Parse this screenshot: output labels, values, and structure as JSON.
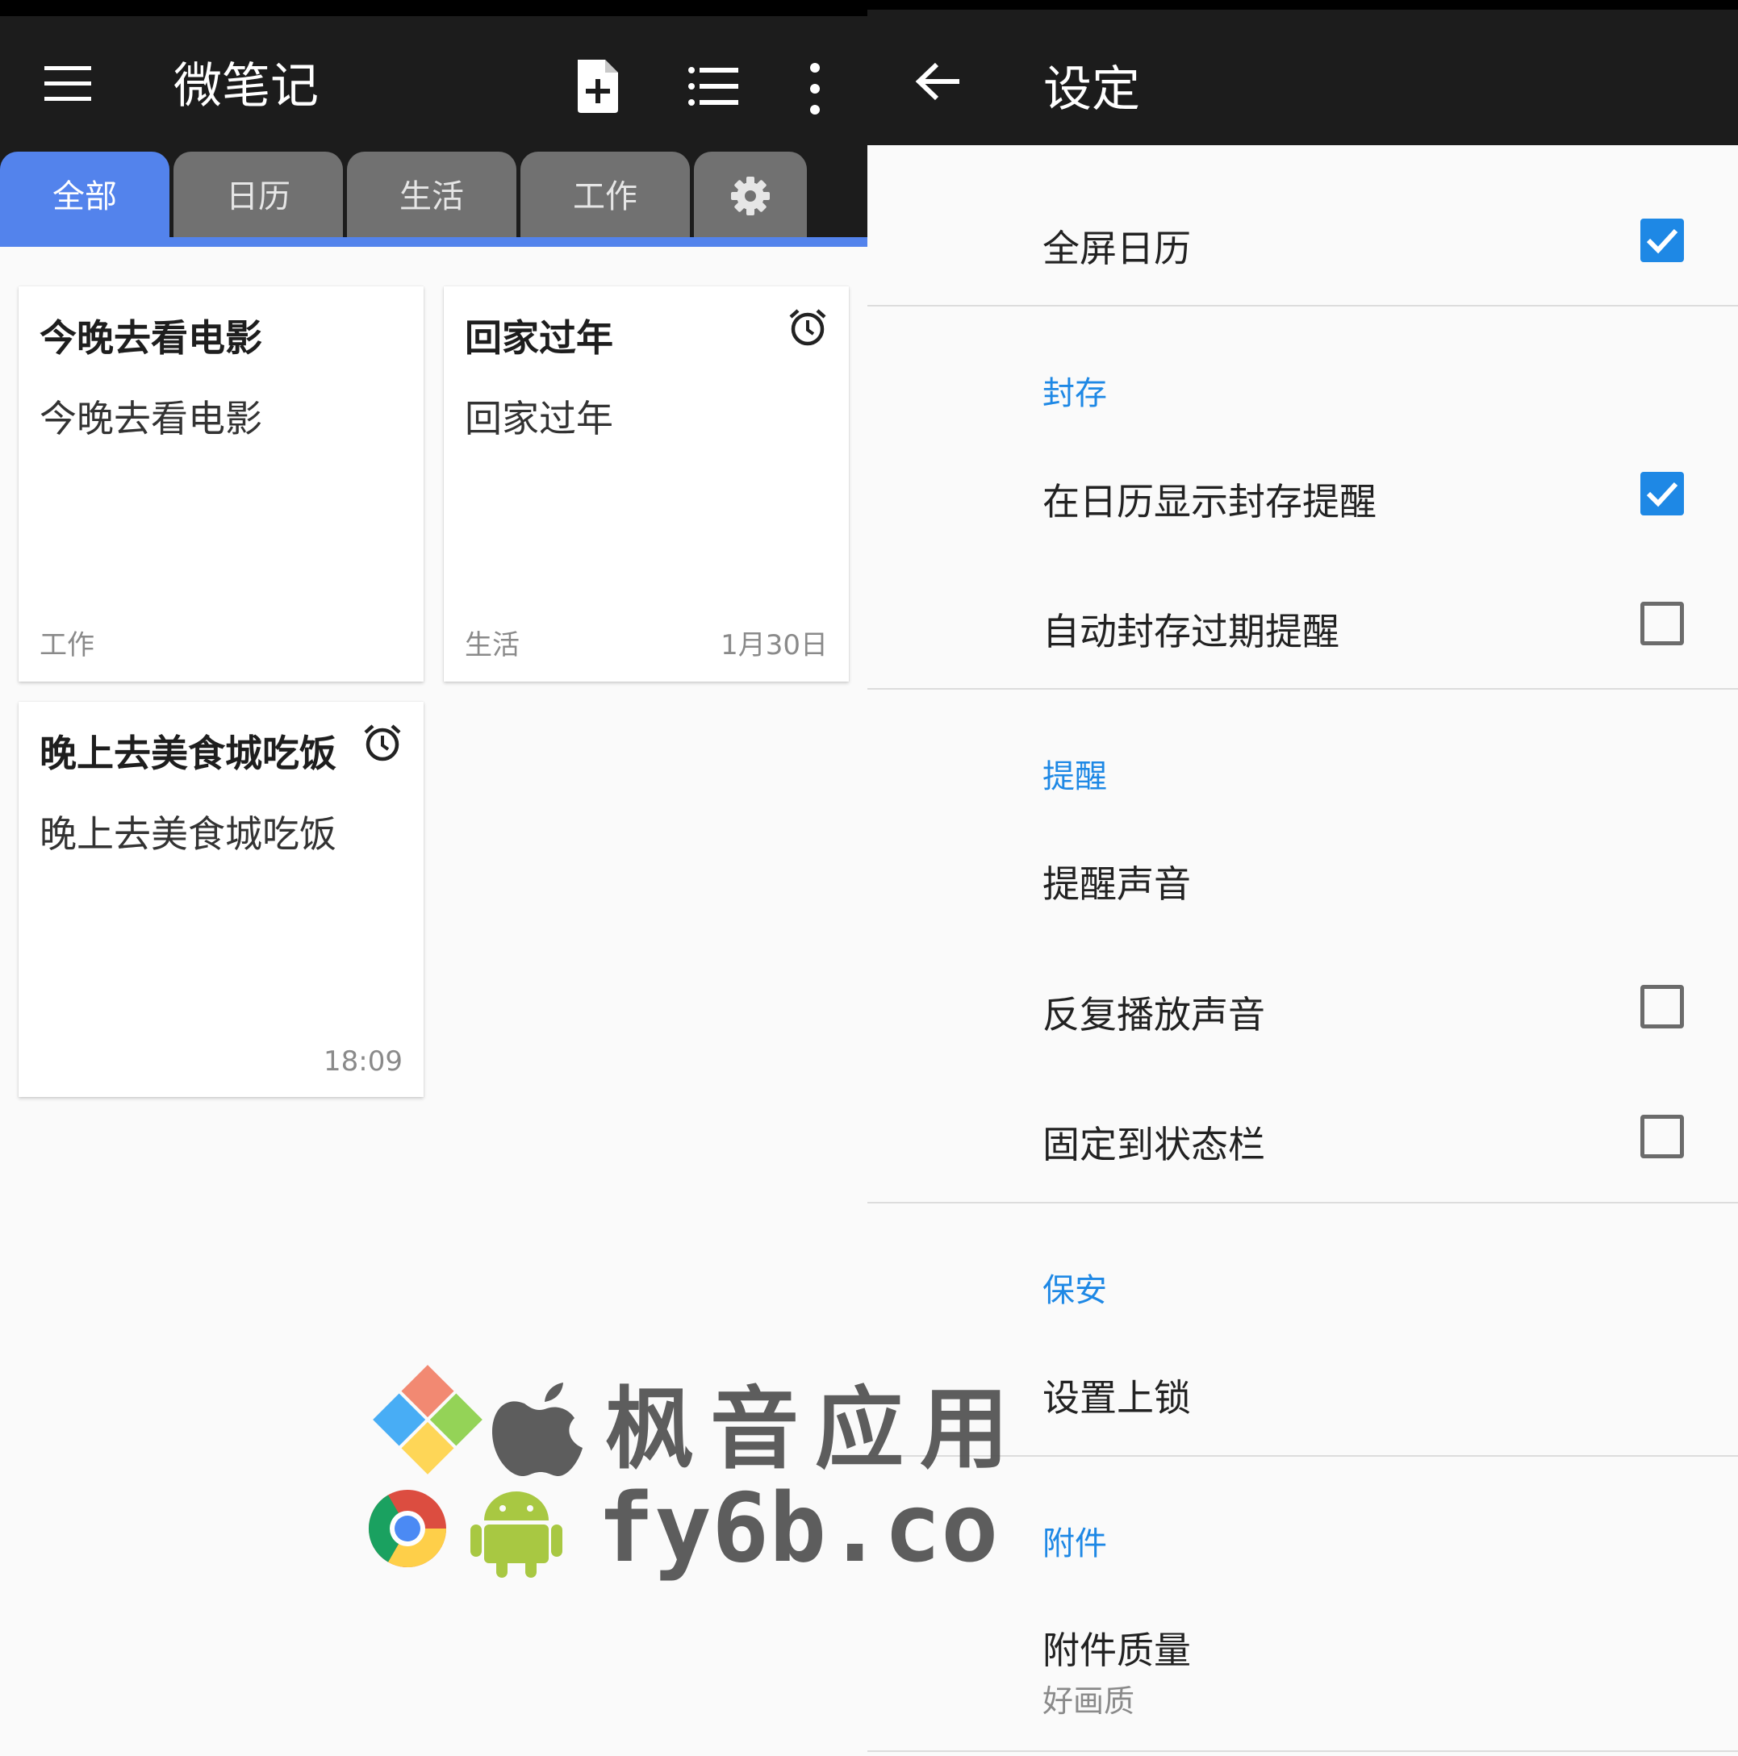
{
  "notes_app": {
    "title": "微笔记",
    "tabs": [
      {
        "label": "全部",
        "active": true
      },
      {
        "label": "日历"
      },
      {
        "label": "生活"
      },
      {
        "label": "工作"
      }
    ],
    "settings_tab_icon": "gear-icon",
    "notes": [
      {
        "title": "今晚去看电影",
        "body": "今晚去看电影",
        "tag": "工作",
        "date": "",
        "has_alarm": false
      },
      {
        "title": "回家过年",
        "body": "回家过年",
        "tag": "生活",
        "date": "1月30日",
        "has_alarm": true
      },
      {
        "title": "晚上去美食城吃饭",
        "body": "晚上去美食城吃饭",
        "tag": "",
        "date": "18:09",
        "has_alarm": true
      }
    ]
  },
  "settings": {
    "title": "设定",
    "items": {
      "fullscreen_calendar": {
        "label": "全屏日历",
        "checked": true
      },
      "archive_header": "封存",
      "show_archived_in_calendar": {
        "label": "在日历显示封存提醒",
        "checked": true
      },
      "auto_archive_expired": {
        "label": "自动封存过期提醒",
        "checked": false
      },
      "reminder_header": "提醒",
      "reminder_sound": {
        "label": "提醒声音"
      },
      "repeat_sound": {
        "label": "反复播放声音",
        "checked": false
      },
      "pin_status_bar": {
        "label": "固定到状态栏",
        "checked": false
      },
      "security_header": "保安",
      "set_lock": {
        "label": "设置上锁"
      },
      "attachment_header": "附件",
      "attachment_quality": {
        "label": "附件质量",
        "summary": "好画质"
      }
    }
  },
  "watermark": {
    "text": "枫音应用",
    "domain": "fy6b.com"
  },
  "colors": {
    "toolbar": "#1c1c1c",
    "tab_active": "#5383ec",
    "tab_inactive": "#717171",
    "accent": "#1e88e5",
    "background": "#fafafa"
  }
}
